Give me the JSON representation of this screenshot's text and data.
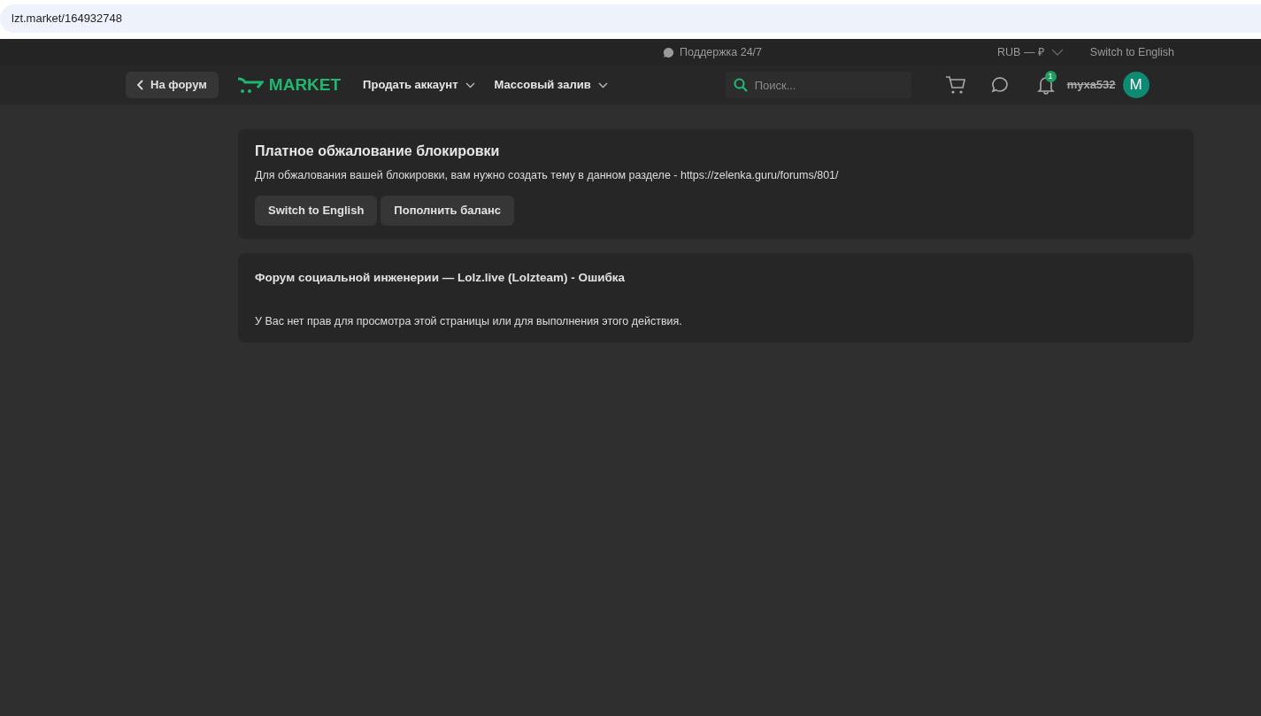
{
  "address_bar": {
    "url": "lzt.market/164932748"
  },
  "top_bar": {
    "support": "Поддержка 24/7",
    "currency": "RUB — ₽",
    "language": "Switch to English"
  },
  "nav": {
    "back": "На форум",
    "logo": "MARKET",
    "menus": [
      {
        "label": "Продать аккаунт"
      },
      {
        "label": "Массовый залив"
      }
    ],
    "search": {
      "placeholder": "Поиск..."
    },
    "notifications": "1",
    "username": "myxa532",
    "avatar": "M"
  },
  "appeal_card": {
    "title": "Платное обжалование блокировки",
    "text": "Для обжалования вашей блокировки, вам нужно создать тему в данном разделе - https://zelenka.guru/forums/801/",
    "buttons": [
      "Switch to English",
      "Пополнить баланс"
    ]
  },
  "error_card": {
    "title": "Форум социальной инженерии — Lolz.live (Lolzteam) - Ошибка",
    "text": "У Вас нет прав для просмотра этой страницы или для выполнения этого действия."
  }
}
